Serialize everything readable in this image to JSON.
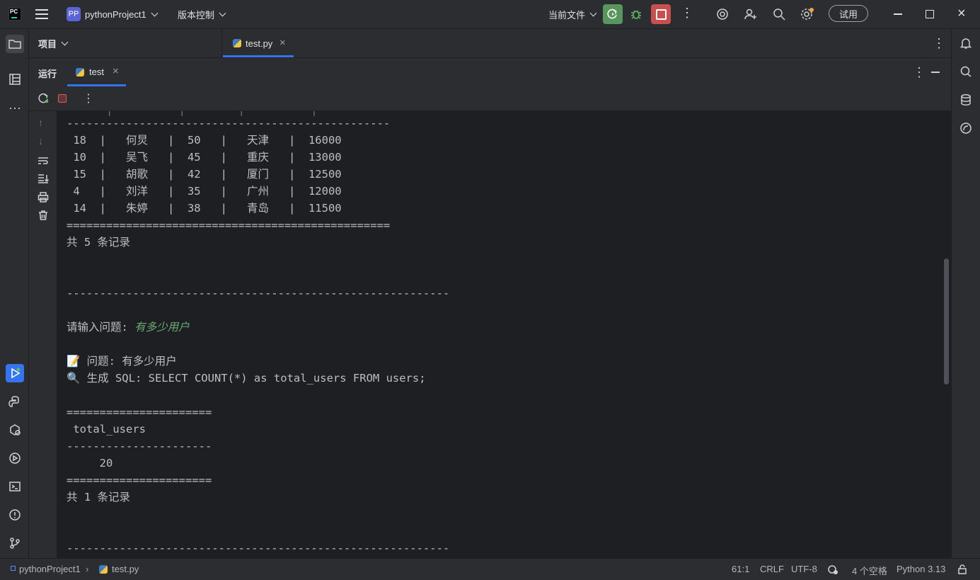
{
  "titlebar": {
    "project_badge": "PP",
    "project_name": "pythonProject1",
    "vcs": "版本控制",
    "run_config": "当前文件",
    "trial": "试用"
  },
  "tabs": {
    "project_panel": "项目",
    "editor_tab": "test.py",
    "run_label": "运行",
    "run_tab": "test"
  },
  "console": {
    "table1_sep_top": "-------------------------------------------------",
    "table1_rows": [
      " 18  |   何炅   |  50   |   天津   |  16000",
      " 10  |   吴飞   |  45   |   重庆   |  13000",
      " 15  |   胡歌   |  42   |   厦门   |  12500",
      " 4   |   刘洋   |  35   |   广州   |  12000",
      " 14  |   朱婷   |  38   |   青岛   |  11500"
    ],
    "table1_sep_bottom": "=================================================",
    "table1_count": "共 5 条记录",
    "divider": "----------------------------------------------------------",
    "prompt_label": "请输入问题: ",
    "prompt_value": "有多少用户",
    "question_line": "📝 问题: 有多少用户",
    "sql_line": "🔍 生成 SQL: SELECT COUNT(*) as total_users FROM users;",
    "table2_sep_top": "======================",
    "table2_header": " total_users",
    "table2_sep_mid": "----------------------",
    "table2_value": "     20",
    "table2_sep_bottom": "======================",
    "table2_count": "共 1 条记录",
    "divider2": "----------------------------------------------------------"
  },
  "statusbar": {
    "project": "pythonProject1",
    "file": "test.py",
    "position": "61:1",
    "line_ending": "CRLF",
    "encoding": "UTF-8",
    "indent": "4 个空格",
    "interpreter": "Python 3.13"
  }
}
